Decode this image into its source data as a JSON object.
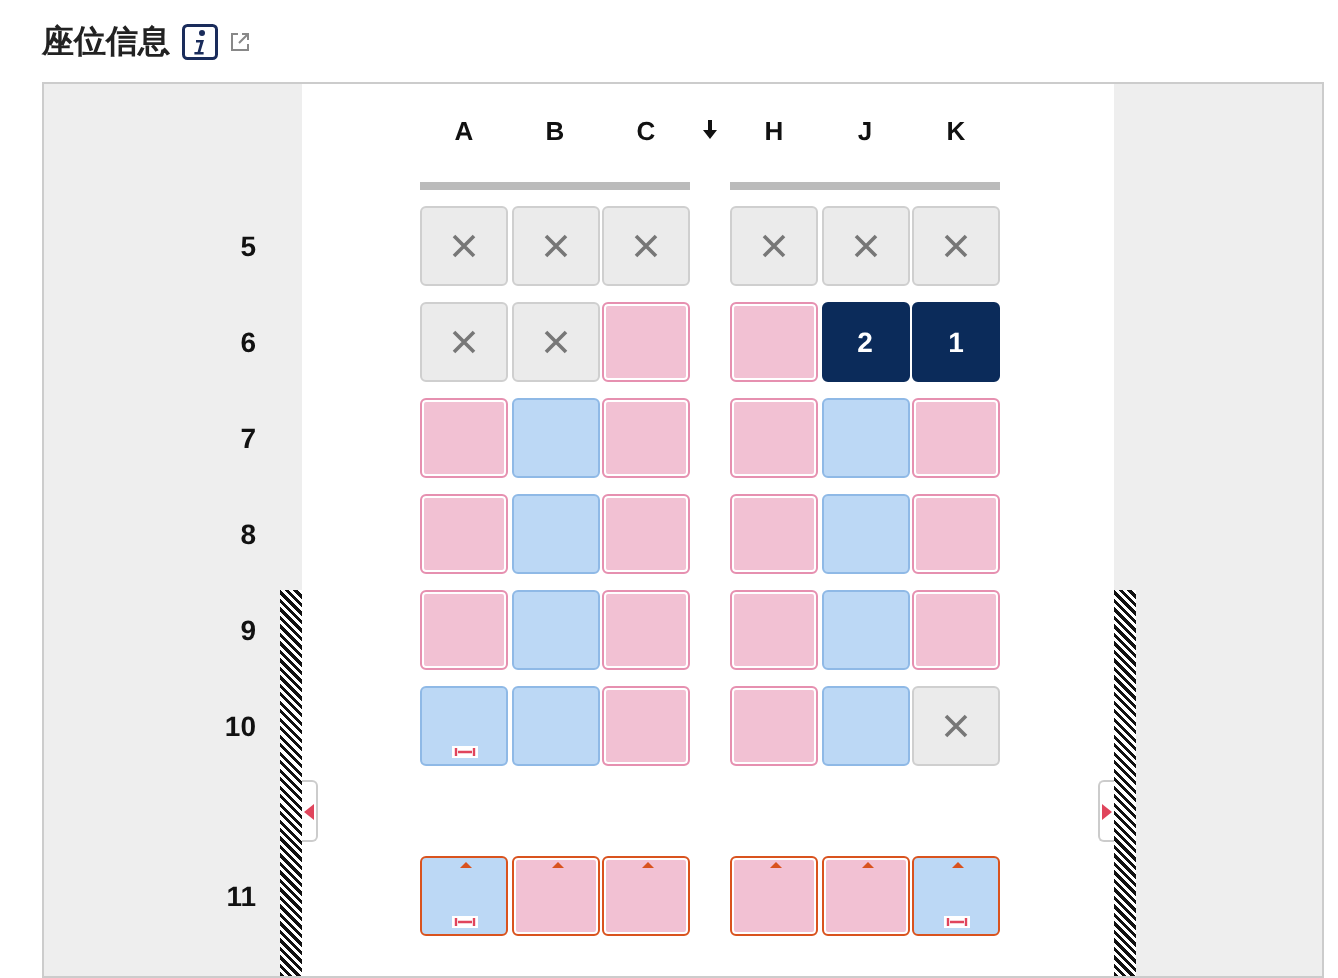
{
  "title": "座位信息",
  "columns": [
    "A",
    "B",
    "C",
    "H",
    "J",
    "K"
  ],
  "rows": [
    {
      "number": "5",
      "seats": [
        {
          "kind": "unavailable"
        },
        {
          "kind": "unavailable"
        },
        {
          "kind": "unavailable"
        },
        {
          "kind": "unavailable"
        },
        {
          "kind": "unavailable"
        },
        {
          "kind": "unavailable"
        }
      ]
    },
    {
      "number": "6",
      "seats": [
        {
          "kind": "unavailable"
        },
        {
          "kind": "unavailable"
        },
        {
          "kind": "premium"
        },
        {
          "kind": "premium"
        },
        {
          "kind": "assigned",
          "label": "2"
        },
        {
          "kind": "assigned",
          "label": "1"
        }
      ]
    },
    {
      "number": "7",
      "seats": [
        {
          "kind": "premium"
        },
        {
          "kind": "standard"
        },
        {
          "kind": "premium"
        },
        {
          "kind": "premium"
        },
        {
          "kind": "standard"
        },
        {
          "kind": "premium"
        }
      ]
    },
    {
      "number": "8",
      "seats": [
        {
          "kind": "premium"
        },
        {
          "kind": "standard"
        },
        {
          "kind": "premium"
        },
        {
          "kind": "premium"
        },
        {
          "kind": "standard"
        },
        {
          "kind": "premium"
        }
      ]
    },
    {
      "number": "9",
      "over_wing": true,
      "seats": [
        {
          "kind": "premium"
        },
        {
          "kind": "standard"
        },
        {
          "kind": "premium"
        },
        {
          "kind": "premium"
        },
        {
          "kind": "standard"
        },
        {
          "kind": "premium"
        }
      ]
    },
    {
      "number": "10",
      "over_wing": true,
      "seats": [
        {
          "kind": "standard",
          "bassinet": true
        },
        {
          "kind": "standard"
        },
        {
          "kind": "premium"
        },
        {
          "kind": "premium"
        },
        {
          "kind": "standard"
        },
        {
          "kind": "unavailable"
        }
      ]
    },
    {
      "number": "11",
      "over_wing": true,
      "exit": true,
      "seats": [
        {
          "kind": "standard",
          "bassinet": true
        },
        {
          "kind": "premium"
        },
        {
          "kind": "premium"
        },
        {
          "kind": "premium"
        },
        {
          "kind": "premium"
        },
        {
          "kind": "standard",
          "bassinet": true
        }
      ]
    }
  ]
}
